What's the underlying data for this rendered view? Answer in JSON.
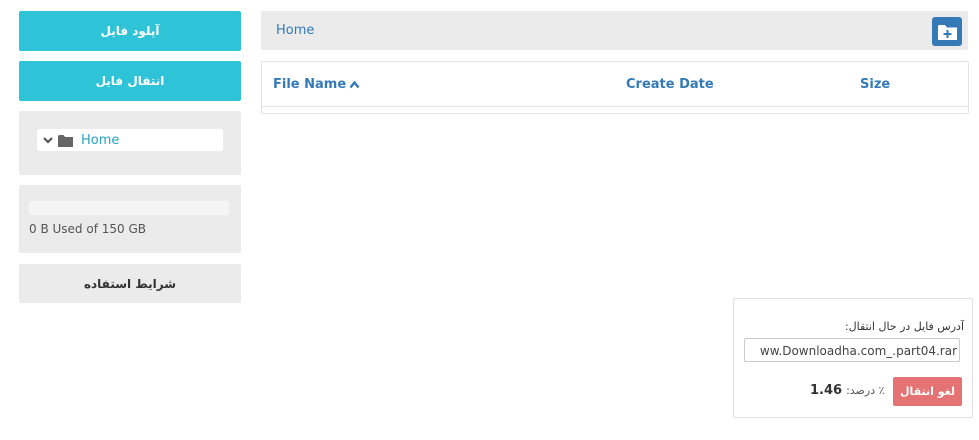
{
  "sidebar": {
    "upload_label": "آپلود فایل",
    "transfer_label": "انتقال فایل",
    "tree": {
      "root_label": "Home"
    },
    "storage": {
      "used_text": "0 B Used of 150 GB",
      "used_fraction": 0
    },
    "terms_label": "شرایط استفاده"
  },
  "breadcrumb": {
    "items": [
      "Home"
    ]
  },
  "table": {
    "columns": {
      "name": "File Name",
      "date": "Create Date",
      "size": "Size"
    },
    "rows": []
  },
  "transfer": {
    "label": "آدرس فایل در حال انتقال:",
    "url_value": "ww.Downloadha.com_.part04.rar",
    "percent_label": "٪ درصد:",
    "percent_value": "1.46",
    "cancel_label": "لغو انتقال"
  },
  "colors": {
    "accent": "#2fc3d8",
    "link": "#337ab7",
    "panel_bg": "#ebebeb",
    "danger": "#e57373"
  }
}
